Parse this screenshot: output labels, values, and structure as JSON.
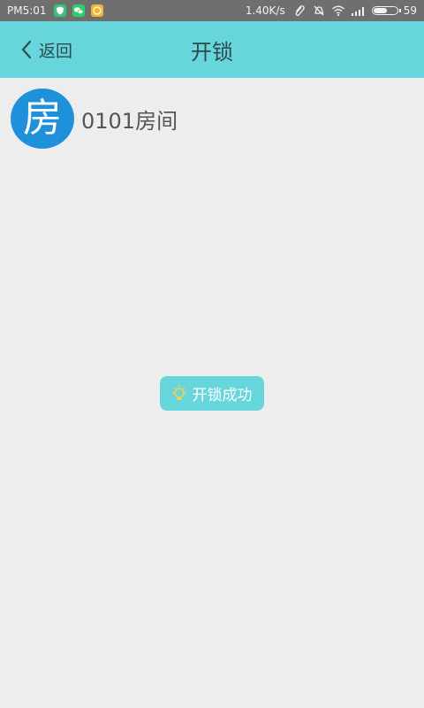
{
  "status_bar": {
    "time": "PM5:01",
    "net_speed": "1.40K/s",
    "battery_level": "59",
    "app_icons": [
      {
        "name": "shield-app-icon",
        "color": "#35C47A"
      },
      {
        "name": "wechat-app-icon",
        "color": "#2DCE6E"
      },
      {
        "name": "smiley-app-icon",
        "color": "#F3B531"
      }
    ],
    "right_icons": [
      "paperclip-icon",
      "bell-off-icon",
      "wifi-icon",
      "signal-icon",
      "battery-icon"
    ]
  },
  "header": {
    "back_label": "返回",
    "title": "开锁",
    "background": "#66D6DC"
  },
  "room": {
    "avatar_char": "房",
    "name": "0101房间",
    "avatar_color": "#1F91DB"
  },
  "toast": {
    "text": "开锁成功",
    "icon": "lightbulb-icon",
    "icon_color": "#F4D34B",
    "background": "#66D6DC"
  }
}
